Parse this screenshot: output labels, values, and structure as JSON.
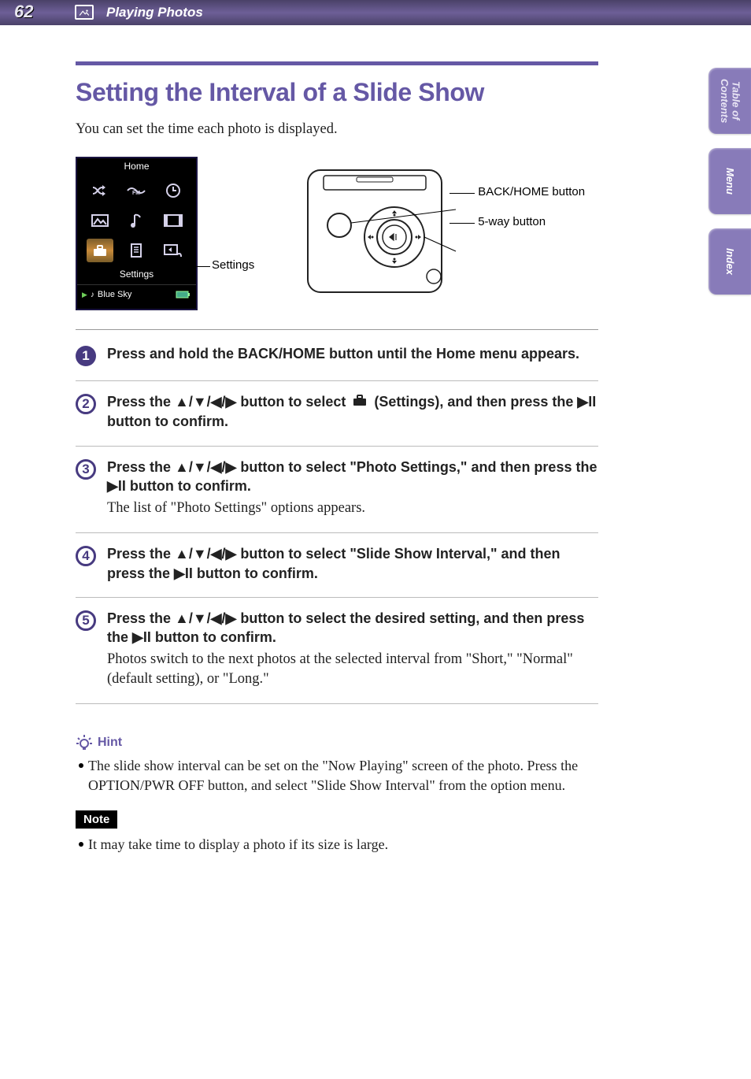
{
  "header": {
    "page_number": "62",
    "section": "Playing Photos"
  },
  "side_tabs": {
    "toc": "Table of Contents",
    "menu": "Menu",
    "index": "Index"
  },
  "page": {
    "title": "Setting the Interval of a Slide Show",
    "intro": "You can set the time each photo is displayed."
  },
  "home_screen": {
    "title": "Home",
    "selected_label": "Settings",
    "now_playing": "Blue Sky"
  },
  "callouts": {
    "settings": "Settings",
    "back_home": "BACK/HOME button",
    "five_way": "5-way button"
  },
  "steps": {
    "s1": "Press and hold the BACK/HOME button until the Home menu appears.",
    "s2a": "Press the ",
    "s2b": " button to select ",
    "s2c": " (Settings), and then press the ",
    "s2d": " button to confirm.",
    "s3a": "Press the ",
    "s3b": " button to select \"Photo Settings,\" and then press the ",
    "s3c": " button to confirm.",
    "s3_plain": "The list of \"Photo Settings\" options appears.",
    "s4a": "Press the ",
    "s4b": " button to select \"Slide Show Interval,\" and then press the ",
    "s4c": " button to confirm.",
    "s5a": "Press the ",
    "s5b": " button to select the desired setting, and then press the ",
    "s5c": " button to confirm.",
    "s5_plain": "Photos switch to the next photos at the selected interval from \"Short,\" \"Normal\" (default setting), or \"Long.\""
  },
  "glyphs": {
    "dpad": "▲/▼/◀/▶",
    "playpause": "▶II"
  },
  "hint": {
    "label": "Hint",
    "text": "The slide show interval can be set on the \"Now Playing\" screen of the photo. Press the OPTION/PWR OFF button, and select \"Slide Show Interval\" from the option menu."
  },
  "note": {
    "label": "Note",
    "text": "It may take time to display a photo if its size is large."
  }
}
